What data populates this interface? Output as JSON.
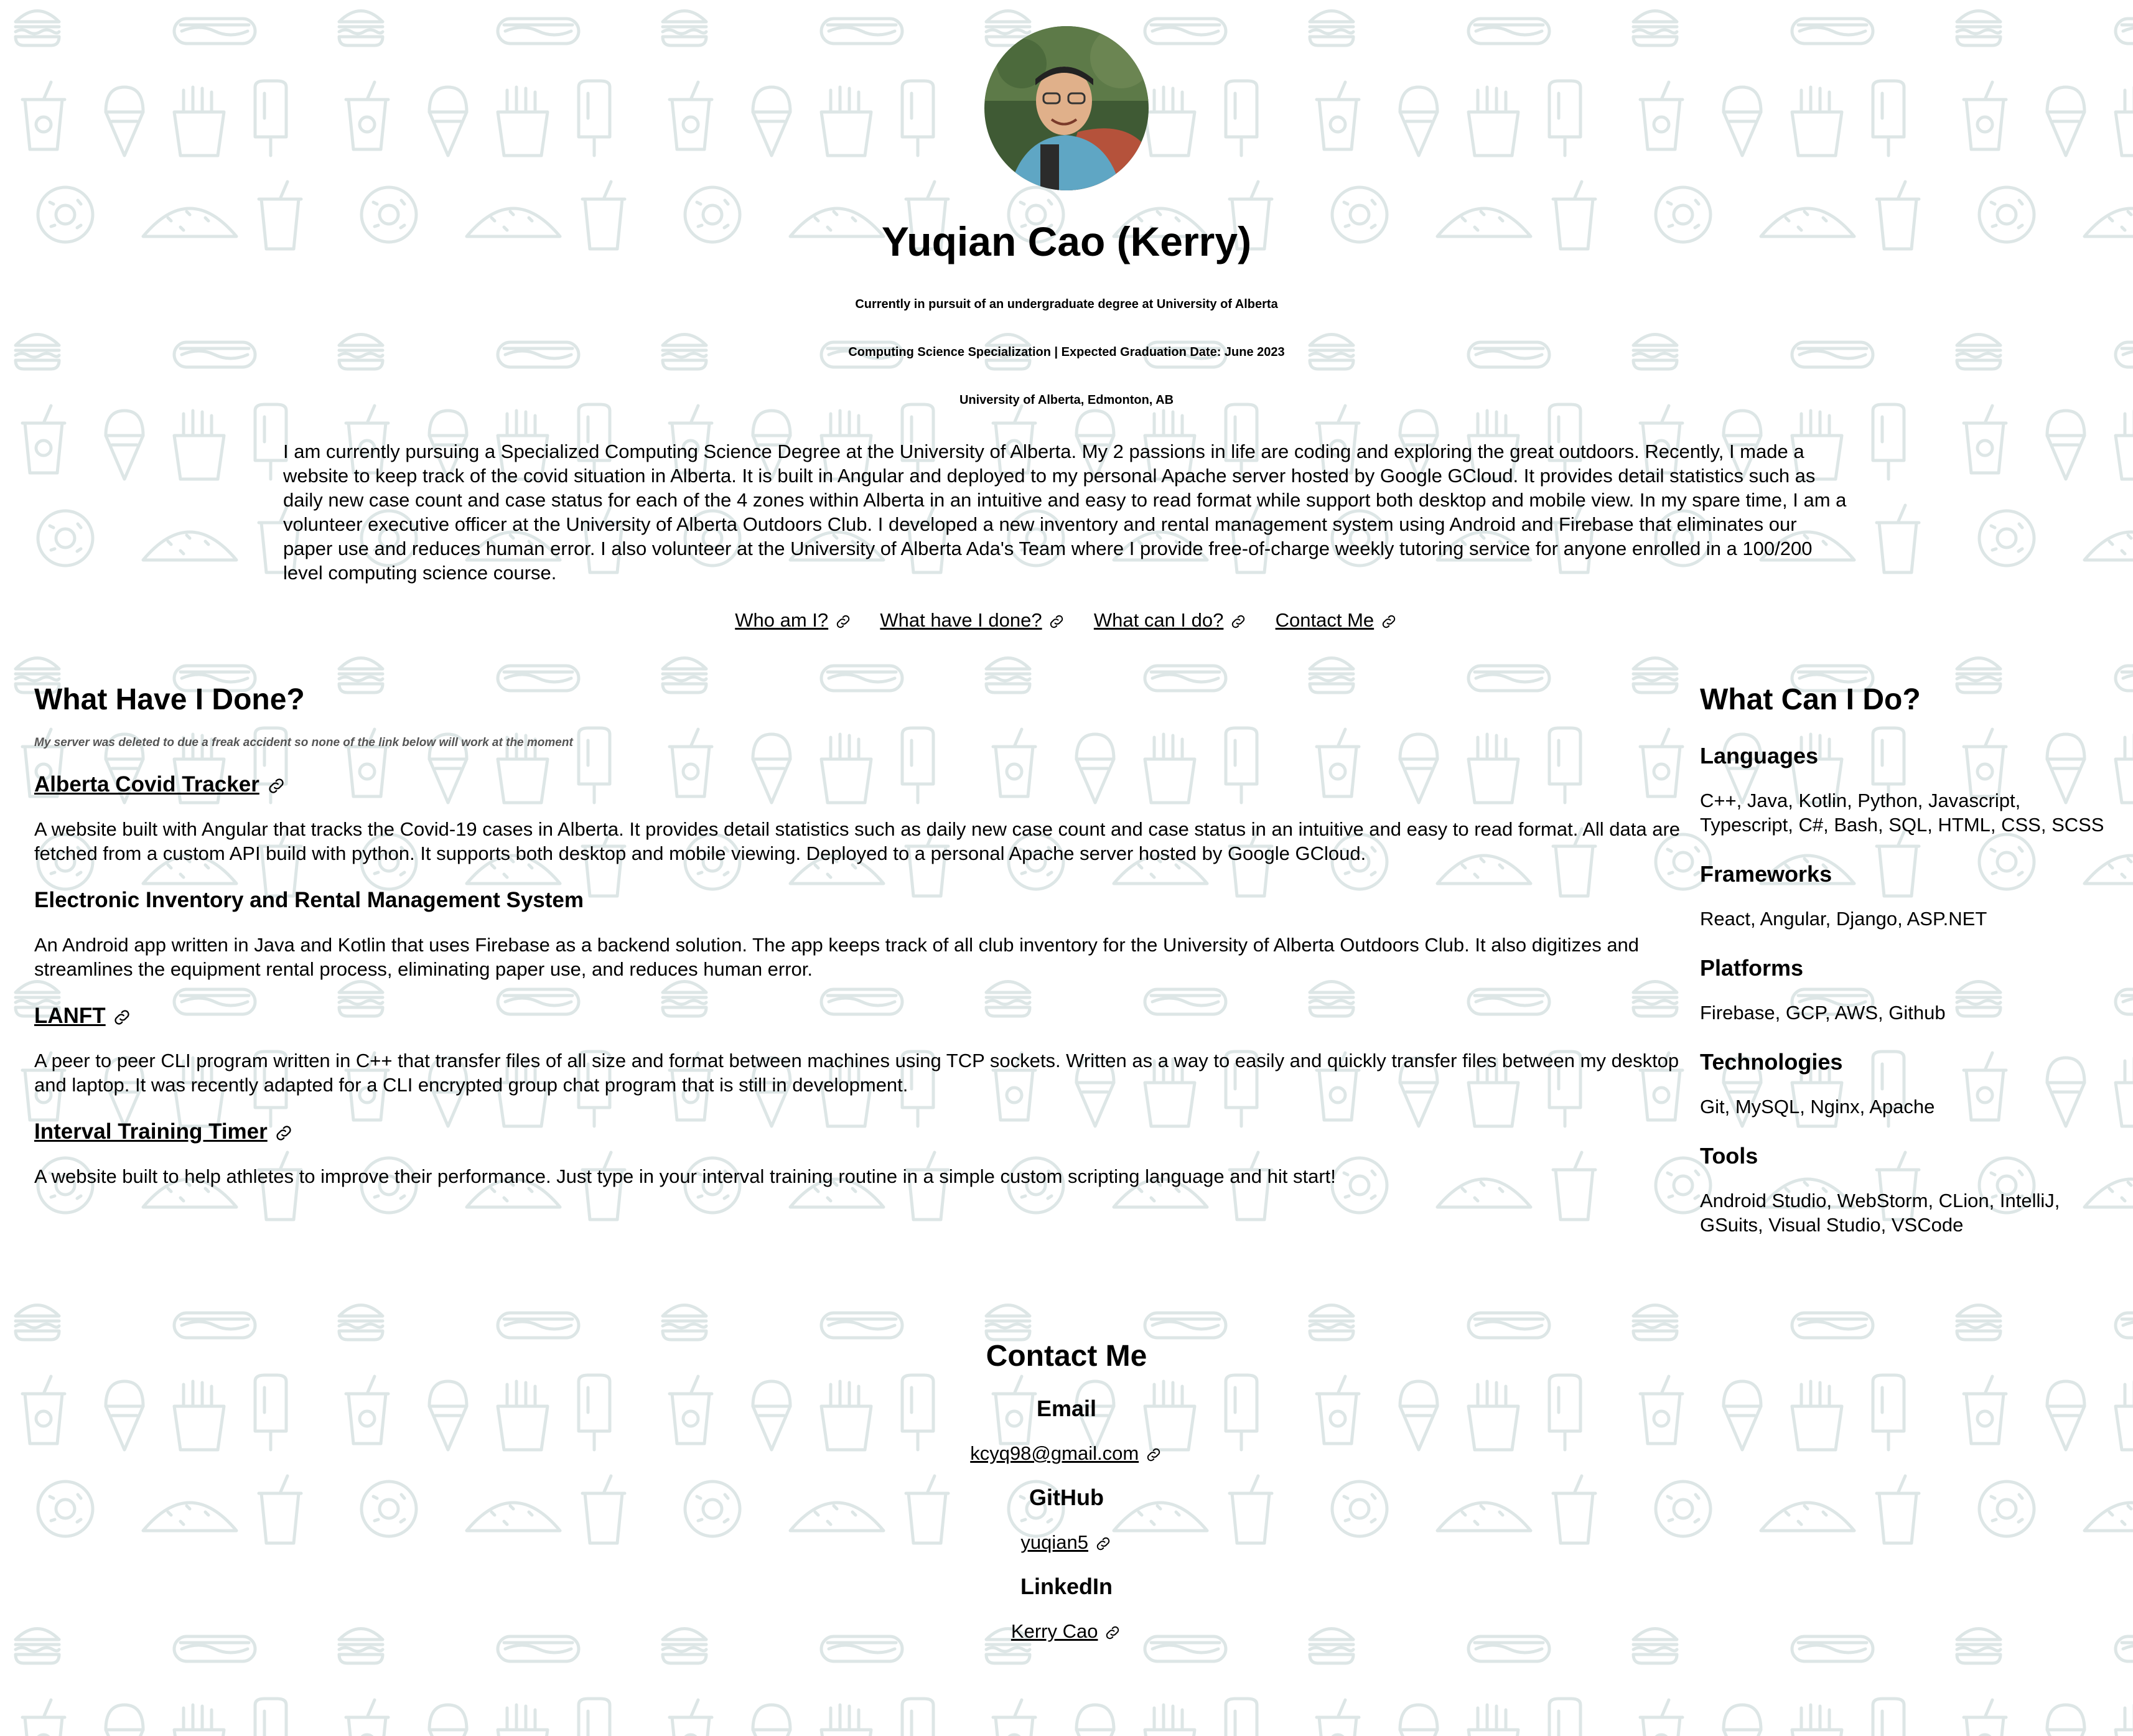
{
  "header": {
    "name": "Yuqian Cao (Kerry)",
    "line1": "Currently in pursuit of an undergraduate degree at University of Alberta",
    "line2": "Computing Science Specialization | Expected Graduation Date: June 2023",
    "line3": "University of Alberta, Edmonton, AB",
    "bio": "I am currently pursuing a Specialized Computing Science Degree at the University of Alberta. My 2 passions in life are coding and exploring the great outdoors. Recently, I made a website to keep track of the covid situation in Alberta. It is built in Angular and deployed to my personal Apache server hosted by Google GCloud. It provides detail statistics such as daily new case count and case status for each of the 4 zones within Alberta in an intuitive and easy to read format while support both desktop and mobile view. In my spare time, I am a volunteer executive officer at the University of Alberta Outdoors Club. I developed a new inventory and rental management system using Android and Firebase that eliminates our paper use and reduces human error. I also volunteer at the University of Alberta Ada's Team where I provide free-of-charge weekly tutoring service for anyone enrolled in a 100/200 level computing science course."
  },
  "nav": {
    "items": [
      "Who am I?",
      "What have I done?",
      "What can I do?",
      "Contact Me"
    ]
  },
  "done": {
    "title": "What Have I Done?",
    "note": "My server was deleted to due a freak accident so none of the link below will work at the moment",
    "projects": [
      {
        "title": "Alberta Covid Tracker",
        "desc": "A website built with Angular that tracks the Covid-19 cases in Alberta. It provides detail statistics such as daily new case count and case status in an intuitive and easy to read format. All data are fetched from a custom API build with python. It supports both desktop and mobile viewing. Deployed to a personal Apache server hosted by Google GCloud."
      },
      {
        "title": "Electronic Inventory and Rental Management System",
        "desc": "An Android app written in Java and Kotlin that uses Firebase as a backend solution. The app keeps track of all club inventory for the University of Alberta Outdoors Club. It also digitizes and streamlines the equipment rental process, eliminating paper use, and reduces human error."
      },
      {
        "title": "LANFT",
        "desc": "A peer to peer CLI program written in C++ that transfer files of all size and format between machines using TCP sockets. Written as a way to easily and quickly transfer files between my desktop and laptop. It was recently adapted for a CLI encrypted group chat program that is still in development."
      },
      {
        "title": "Interval Training Timer",
        "desc": "A website built to help athletes to improve their performance. Just type in your interval training routine in a simple custom scripting language and hit start!"
      }
    ]
  },
  "can": {
    "title": "What Can I Do?",
    "groups": [
      {
        "label": "Languages",
        "text": "C++, Java, Kotlin, Python, Javascript, Typescript, C#, Bash, SQL, HTML, CSS, SCSS"
      },
      {
        "label": "Frameworks",
        "text": "React, Angular, Django, ASP.NET"
      },
      {
        "label": "Platforms",
        "text": "Firebase, GCP, AWS, Github"
      },
      {
        "label": "Technologies",
        "text": "Git, MySQL, Nginx, Apache"
      },
      {
        "label": "Tools",
        "text": "Android Studio, WebStorm, CLion, IntelliJ, GSuits, Visual Studio, VSCode"
      }
    ]
  },
  "contact": {
    "title": "Contact Me",
    "email_label": "Email",
    "email": "kcyq98@gmail.com",
    "github_label": "GitHub",
    "github": "yuqian5",
    "linkedin_label": "LinkedIn",
    "linkedin": "Kerry Cao"
  },
  "colors": {
    "pattern": "#dde6e6",
    "text": "#000000",
    "note": "#555555"
  },
  "icons": [
    "link-icon",
    "burger-icon",
    "hotdog-icon",
    "cup-icon",
    "icecream-icon",
    "fries-icon",
    "popsicle-icon",
    "donut-icon",
    "taco-icon"
  ]
}
